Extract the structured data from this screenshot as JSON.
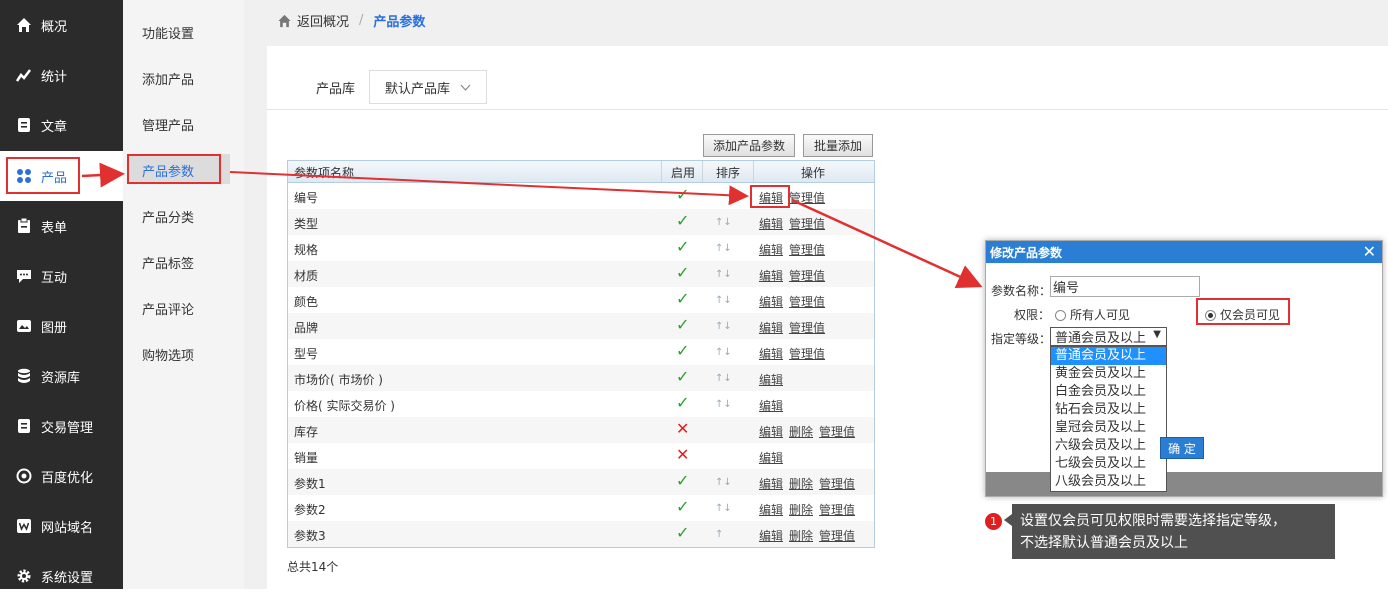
{
  "nav": {
    "items": [
      {
        "label": "概况",
        "icon": "home-icon"
      },
      {
        "label": "统计",
        "icon": "stats-icon"
      },
      {
        "label": "文章",
        "icon": "article-icon"
      },
      {
        "label": "产品",
        "icon": "grid-icon"
      },
      {
        "label": "表单",
        "icon": "form-icon"
      },
      {
        "label": "互动",
        "icon": "chat-icon"
      },
      {
        "label": "图册",
        "icon": "album-icon"
      },
      {
        "label": "资源库",
        "icon": "database-icon"
      },
      {
        "label": "交易管理",
        "icon": "trade-icon"
      },
      {
        "label": "百度优化",
        "icon": "seo-icon"
      },
      {
        "label": "网站域名",
        "icon": "domain-icon"
      },
      {
        "label": "系统设置",
        "icon": "gear-icon"
      }
    ]
  },
  "submenu": {
    "items": [
      "功能设置",
      "添加产品",
      "管理产品",
      "产品参数",
      "产品分类",
      "产品标签",
      "产品评论",
      "购物选项"
    ]
  },
  "breadcrumb": {
    "back": "返回概况",
    "sep": "/",
    "current": "产品参数"
  },
  "library": {
    "label": "产品库",
    "value": "默认产品库"
  },
  "toolbar": {
    "add_label": "添加产品参数",
    "batch_label": "批量添加"
  },
  "table": {
    "headers": [
      "参数项名称",
      "启用",
      "排序",
      "操作"
    ],
    "rows": [
      {
        "name": "编号",
        "enabled": true,
        "arrows": "",
        "ops": [
          "编辑",
          "管理值"
        ]
      },
      {
        "name": "类型",
        "enabled": true,
        "arrows": "↑↓",
        "ops": [
          "编辑",
          "管理值"
        ]
      },
      {
        "name": "规格",
        "enabled": true,
        "arrows": "↑↓",
        "ops": [
          "编辑",
          "管理值"
        ]
      },
      {
        "name": "材质",
        "enabled": true,
        "arrows": "↑↓",
        "ops": [
          "编辑",
          "管理值"
        ]
      },
      {
        "name": "颜色",
        "enabled": true,
        "arrows": "↑↓",
        "ops": [
          "编辑",
          "管理值"
        ]
      },
      {
        "name": "品牌",
        "enabled": true,
        "arrows": "↑↓",
        "ops": [
          "编辑",
          "管理值"
        ]
      },
      {
        "name": "型号",
        "enabled": true,
        "arrows": "↑↓",
        "ops": [
          "编辑",
          "管理值"
        ]
      },
      {
        "name": "市场价( 市场价 )",
        "enabled": true,
        "arrows": "↑↓",
        "ops": [
          "编辑"
        ]
      },
      {
        "name": "价格( 实际交易价 )",
        "enabled": true,
        "arrows": "↑↓",
        "ops": [
          "编辑"
        ]
      },
      {
        "name": "库存",
        "enabled": false,
        "arrows": "",
        "ops": [
          "编辑",
          "删除",
          "管理值"
        ]
      },
      {
        "name": "销量",
        "enabled": false,
        "arrows": "",
        "ops": [
          "编辑"
        ]
      },
      {
        "name": "参数1",
        "enabled": true,
        "arrows": "↑↓",
        "ops": [
          "编辑",
          "删除",
          "管理值"
        ]
      },
      {
        "name": "参数2",
        "enabled": true,
        "arrows": "↑↓",
        "ops": [
          "编辑",
          "删除",
          "管理值"
        ]
      },
      {
        "name": "参数3",
        "enabled": true,
        "arrows": "↑",
        "ops": [
          "编辑",
          "删除",
          "管理值"
        ]
      }
    ],
    "check_mark": "✓",
    "cross_mark": "✕",
    "total": "总共14个"
  },
  "dialog": {
    "title": "修改产品参数",
    "close": "✕",
    "name_label": "参数名称：",
    "name_value": "编号",
    "perm_label": "权限：",
    "perm_all": "所有人可见",
    "perm_member": "仅会员可见",
    "level_label": "指定等级：",
    "level_value": "普通会员及以上",
    "level_options": [
      "普通会员及以上",
      "黄金会员及以上",
      "白金会员及以上",
      "钻石会员及以上",
      "皇冠会员及以上",
      "六级会员及以上",
      "七级会员及以上",
      "八级会员及以上"
    ],
    "ok_label": "确 定"
  },
  "tip": {
    "badge": "1",
    "text_line1": "设置仅会员可见权限时需要选择指定等级，",
    "text_line2": "不选择默认普通会员及以上"
  },
  "colors": {
    "accent": "#2a6fdb",
    "highlight": "#e03030",
    "sidebar": "#2b2b2b"
  }
}
